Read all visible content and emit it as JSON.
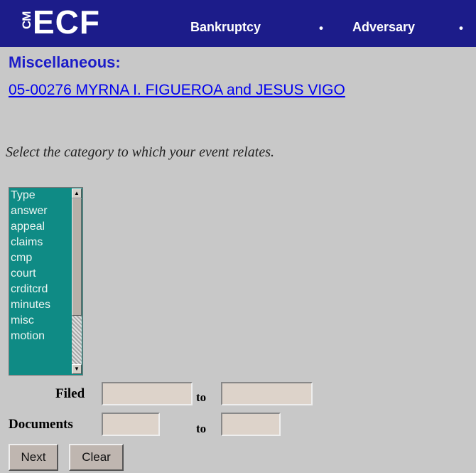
{
  "header": {
    "logo_prefix": "CM",
    "logo_text": "ECF",
    "nav": [
      {
        "label": "Bankruptcy"
      },
      {
        "label": "Adversary"
      }
    ],
    "separator": "•"
  },
  "page": {
    "heading": "Miscellaneous:",
    "case_link": "05-00276 MYRNA I. FIGUEROA and JESUS VIGO",
    "instruction": "Select the category to which your event relates."
  },
  "category_list": {
    "items": [
      "Type",
      "answer",
      "appeal",
      "claims",
      "cmp",
      "court",
      "crditcrd",
      "minutes",
      "misc",
      "motion"
    ]
  },
  "form": {
    "filed_label": "Filed",
    "documents_label": "Documents",
    "to_label": "to",
    "filed_from_value": "",
    "filed_to_value": "",
    "documents_from_value": "",
    "documents_to_value": ""
  },
  "buttons": {
    "next": "Next",
    "clear": "Clear"
  },
  "colors": {
    "header_bg": "#1c1c8a",
    "page_bg": "#c8c8c8",
    "listbox_bg": "#0f8b85",
    "heading": "#1c1cc8",
    "link": "#0000ee"
  }
}
